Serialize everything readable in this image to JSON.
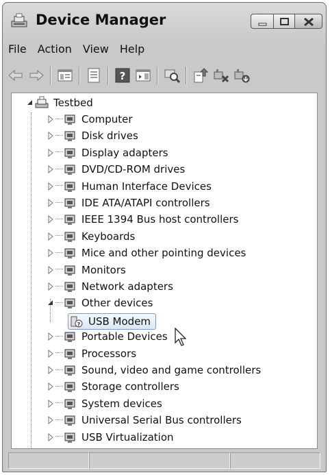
{
  "window": {
    "title": "Device Manager"
  },
  "menu": [
    "File",
    "Action",
    "View",
    "Help"
  ],
  "toolbar": {
    "buttons": [
      "back-arrow-icon",
      "forward-arrow-icon",
      "show-hide-tree-icon",
      "properties-icon",
      "help-icon",
      "action-pane-icon",
      "scan-hardware-icon",
      "update-driver-icon",
      "disable-device-icon",
      "uninstall-device-icon"
    ]
  },
  "tree": {
    "root": "Testbed",
    "categories": [
      "Computer",
      "Disk drives",
      "Display adapters",
      "DVD/CD-ROM drives",
      "Human Interface Devices",
      "IDE ATA/ATAPI controllers",
      "IEEE 1394 Bus host controllers",
      "Keyboards",
      "Mice and other pointing devices",
      "Monitors",
      "Network adapters",
      "Other devices",
      "Portable Devices",
      "Processors",
      "Sound, video and game controllers",
      "Storage controllers",
      "System devices",
      "Universal Serial Bus controllers",
      "USB Virtualization"
    ],
    "expanded_category": "Other devices",
    "selected_device": "USB Modem"
  }
}
